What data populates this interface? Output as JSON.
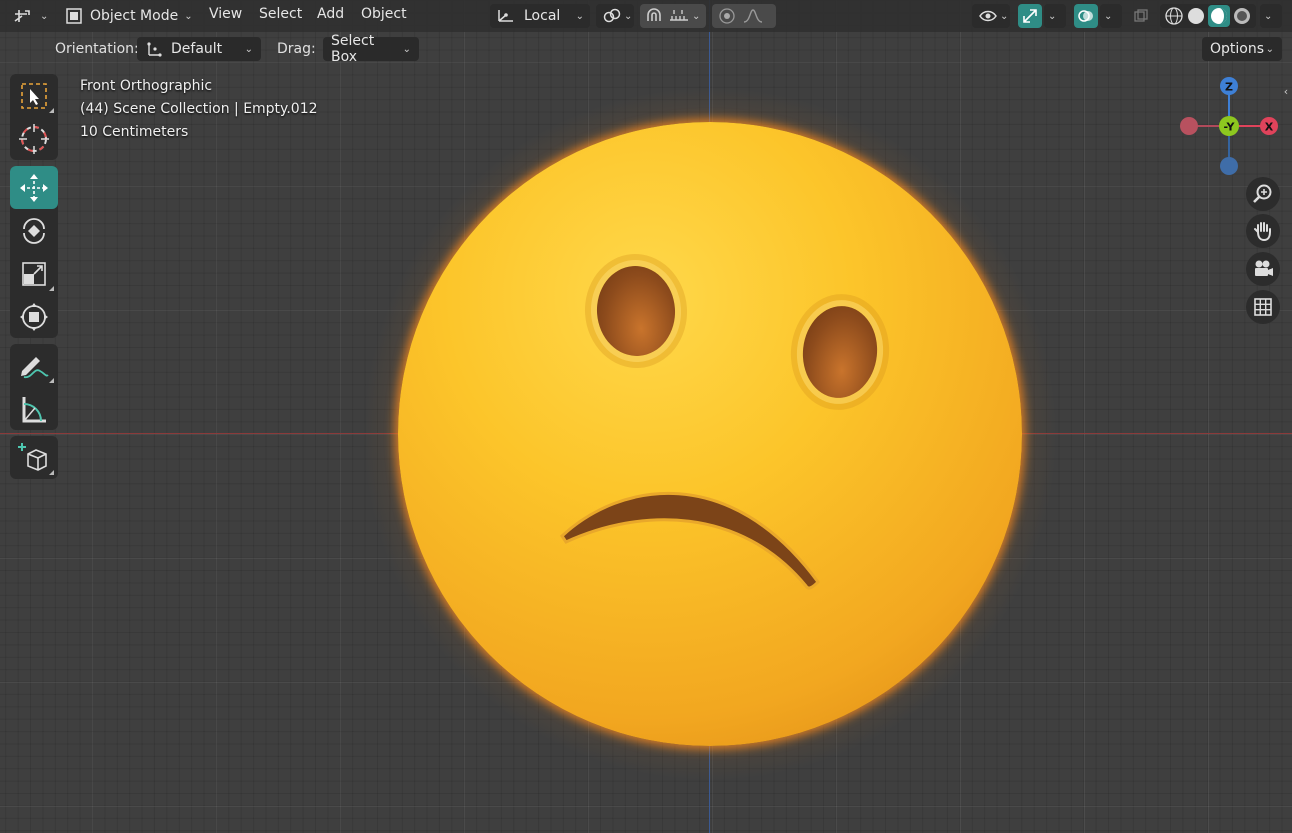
{
  "header": {
    "mode_label": "Object Mode",
    "menu": [
      "View",
      "Select",
      "Add",
      "Object"
    ],
    "transform_orientation": "Local",
    "options_label": "Options"
  },
  "tool_settings": {
    "orientation_label": "Orientation:",
    "orientation_value": "Default",
    "drag_label": "Drag:",
    "drag_value": "Select Box"
  },
  "viewport_info": {
    "view_name": "Front Orthographic",
    "collection_line": "(44) Scene Collection | Empty.012",
    "scale_line": "10 Centimeters"
  },
  "gizmo": {
    "z_label": "Z",
    "y_label": "-Y",
    "x_label": "X",
    "colors": {
      "x": "#e0435b",
      "y": "#8dc71f",
      "z": "#3e80d6"
    }
  },
  "left_tools": [
    "select-box",
    "cursor",
    "move",
    "rotate",
    "scale",
    "transform",
    "annotate",
    "measure",
    "add-cube"
  ],
  "nav_buttons": [
    "zoom-icon",
    "hand-pan-icon",
    "camera-icon",
    "grid-icon"
  ],
  "colors": {
    "accent": "#2f8d86",
    "background": "#3f3f3f",
    "emoji_yellow": "#fcc52a"
  }
}
